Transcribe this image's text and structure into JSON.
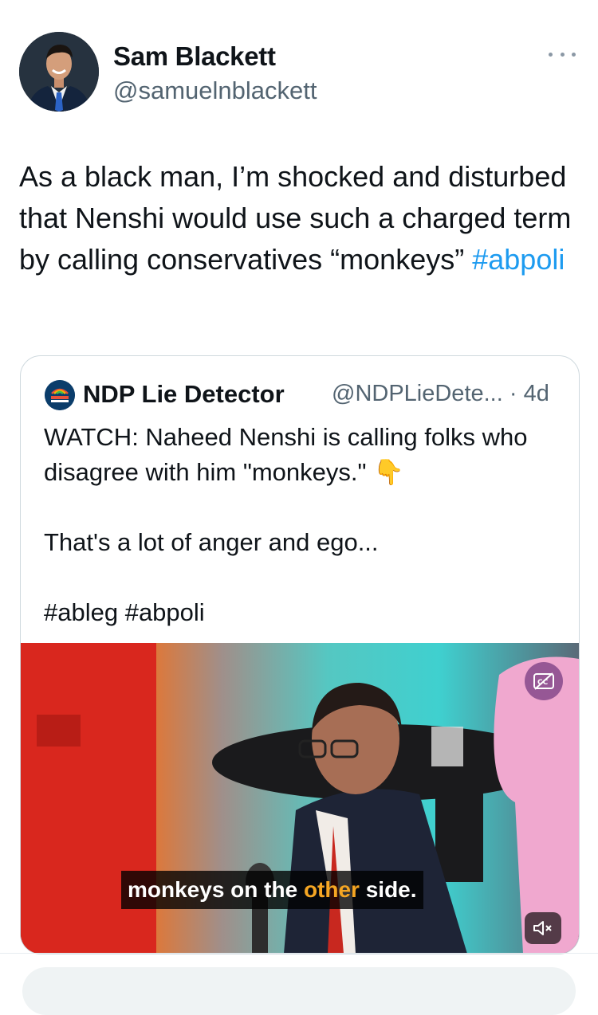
{
  "tweet": {
    "author_name": "Sam Blackett",
    "author_handle": "@samuelnblackett",
    "text_before": "As a black man, I’m shocked and disturbed that Nenshi would use such a charged term by calling conservatives “monkeys”",
    "hashtag": "#abpoli"
  },
  "quoted_tweet": {
    "author_name": "NDP Lie Detector",
    "author_handle": "@NDPLieDete...",
    "time": "· 4d",
    "line1": "WATCH: Naheed Nenshi is calling folks who disagree with him \"monkeys.\"",
    "emoji": "👇",
    "line2": "That's a lot of anger and ego...",
    "hashtags": "#ableg #abpoli",
    "logo_text": "NDP LIE DETECTOR",
    "video": {
      "caption_pre": "monkeys on the ",
      "caption_highlight": "other",
      "caption_post": " side."
    }
  },
  "colors": {
    "link": "#1d9bf0",
    "secondary_text": "#536471",
    "border": "#cfd9de",
    "caption_highlight": "#f5a623"
  },
  "icons": [
    "more-options-icon",
    "closed-captions-icon",
    "mute-icon"
  ]
}
